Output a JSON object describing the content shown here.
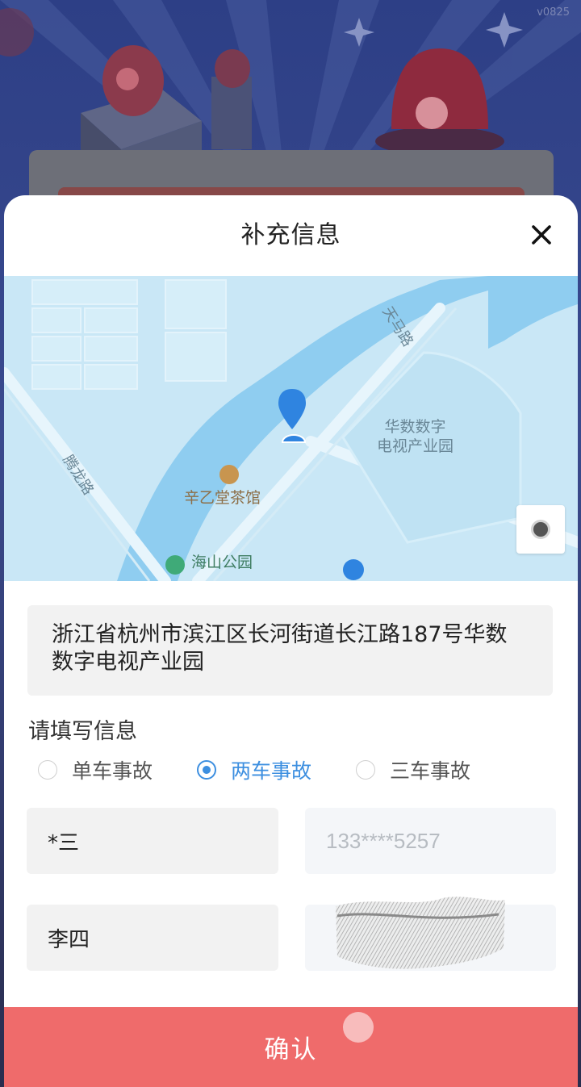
{
  "app": {
    "version": "v0825"
  },
  "modal": {
    "title": "补充信息",
    "close_label": "×"
  },
  "map": {
    "labels": {
      "road_tiandi": "天马路",
      "road_tenglong": "腾龙路",
      "park_area": "华数数字\n电视产业园",
      "tea_house": "辛乙堂茶馆",
      "haishan_park": "海山公园"
    }
  },
  "address": {
    "text": "浙江省杭州市滨江区长河街道长江路187号华数数字电视产业园"
  },
  "form": {
    "section_label": "请填写信息",
    "accident_types": [
      {
        "label": "单车事故",
        "checked": false
      },
      {
        "label": "两车事故",
        "checked": true
      },
      {
        "label": "三车事故",
        "checked": false
      }
    ],
    "party1_name": "*三",
    "party1_phone": "133****5257",
    "party2_name": "李四",
    "party2_phone": ""
  },
  "actions": {
    "confirm_label": "确认"
  },
  "colors": {
    "accent": "#3d8fe0",
    "confirm": "#ef6b6b",
    "map_bg": "#c9e7f6"
  }
}
